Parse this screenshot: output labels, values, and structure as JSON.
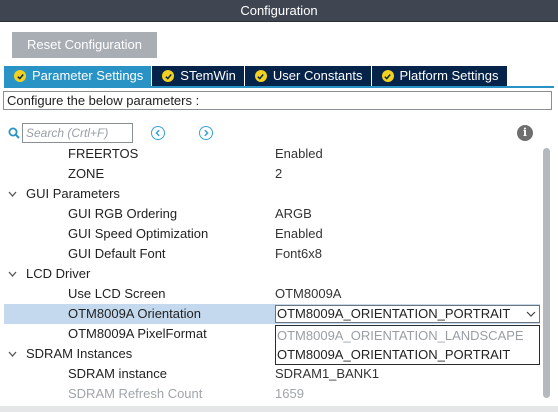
{
  "window": {
    "title": "Configuration"
  },
  "toolbar": {
    "reset_label": "Reset Configuration"
  },
  "tabs": [
    {
      "label": "Parameter Settings",
      "active": true
    },
    {
      "label": "STemWin",
      "active": false
    },
    {
      "label": "User Constants",
      "active": false
    },
    {
      "label": "Platform Settings",
      "active": false
    }
  ],
  "configure_text": "Configure the below parameters :",
  "search": {
    "placeholder": "Search (Crtl+F)"
  },
  "tree": {
    "freertos": {
      "label": "FREERTOS",
      "value": "Enabled"
    },
    "zone": {
      "label": "ZONE",
      "value": "2"
    },
    "gui_parameters": {
      "label": "GUI Parameters"
    },
    "gui_rgb_ordering": {
      "label": "GUI RGB Ordering",
      "value": "ARGB"
    },
    "gui_speed_optimization": {
      "label": "GUI Speed Optimization",
      "value": "Enabled"
    },
    "gui_default_font": {
      "label": "GUI Default Font",
      "value": "Font6x8"
    },
    "lcd_driver": {
      "label": "LCD Driver"
    },
    "use_lcd_screen": {
      "label": "Use LCD Screen",
      "value": "OTM8009A"
    },
    "otm_orientation": {
      "label": "OTM8009A Orientation",
      "value": "OTM8009A_ORIENTATION_PORTRAIT"
    },
    "otm_pixelformat": {
      "label": "OTM8009A PixelFormat",
      "value": ""
    },
    "sdram_instances": {
      "label": "SDRAM Instances"
    },
    "sdram_instance": {
      "label": "SDRAM instance",
      "value": "SDRAM1_BANK1"
    },
    "sdram_refresh_count": {
      "label": "SDRAM Refresh Count",
      "value": "1659"
    }
  },
  "dropdown": {
    "options": [
      "OTM8009A_ORIENTATION_LANDSCAPE",
      "OTM8009A_ORIENTATION_PORTRAIT"
    ]
  },
  "colors": {
    "titlebar": "#3f4551",
    "tab_active": "#2a93c6",
    "tab_inactive": "#06234a",
    "check_badge": "#f2d21f",
    "selected_row": "#c4d9ee"
  }
}
